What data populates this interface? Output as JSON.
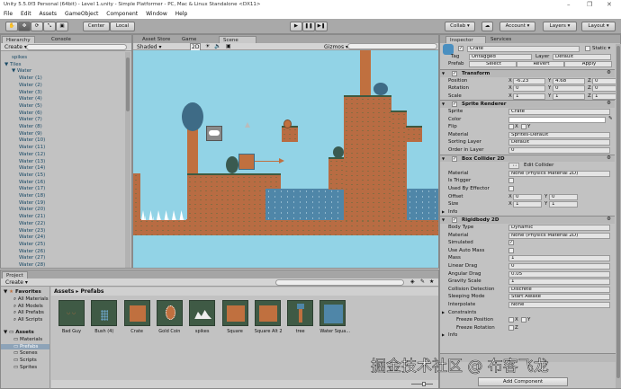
{
  "window": {
    "title": "Unity 5.5.0f3 Personal (64bit) - Level 1.unity - Simple Platformer - PC, Mac & Linux Standalone <DX11>",
    "minimize": "–",
    "maximize": "❐",
    "close": "✕"
  },
  "menu": [
    "File",
    "Edit",
    "Assets",
    "GameObject",
    "Component",
    "Window",
    "Help"
  ],
  "toolbar": {
    "center": "Center",
    "local": "Local",
    "collab": "Collab ▾",
    "account": "Account ▾",
    "layers": "Layers ▾",
    "layout": "Layout ▾",
    "play": "▶",
    "pause": "❚❚",
    "step": "▶❚"
  },
  "hierarchy": {
    "tab": "Hierarchy",
    "console_tab": "Console",
    "create": "Create ▾",
    "items": [
      {
        "label": "spikes",
        "indent": 1
      },
      {
        "label": "▼ Tiles",
        "indent": 0
      },
      {
        "label": "▼ Water",
        "indent": 1
      },
      {
        "label": "Water (1)",
        "indent": 2
      },
      {
        "label": "Water (2)",
        "indent": 2
      },
      {
        "label": "Water (3)",
        "indent": 2
      },
      {
        "label": "Water (4)",
        "indent": 2
      },
      {
        "label": "Water (5)",
        "indent": 2
      },
      {
        "label": "Water (6)",
        "indent": 2
      },
      {
        "label": "Water (7)",
        "indent": 2
      },
      {
        "label": "Water (8)",
        "indent": 2
      },
      {
        "label": "Water (9)",
        "indent": 2
      },
      {
        "label": "Water (10)",
        "indent": 2
      },
      {
        "label": "Water (11)",
        "indent": 2
      },
      {
        "label": "Water (12)",
        "indent": 2
      },
      {
        "label": "Water (13)",
        "indent": 2
      },
      {
        "label": "Water (14)",
        "indent": 2
      },
      {
        "label": "Water (15)",
        "indent": 2
      },
      {
        "label": "Water (16)",
        "indent": 2
      },
      {
        "label": "Water (17)",
        "indent": 2
      },
      {
        "label": "Water (18)",
        "indent": 2
      },
      {
        "label": "Water (19)",
        "indent": 2
      },
      {
        "label": "Water (20)",
        "indent": 2
      },
      {
        "label": "Water (21)",
        "indent": 2
      },
      {
        "label": "Water (22)",
        "indent": 2
      },
      {
        "label": "Water (23)",
        "indent": 2
      },
      {
        "label": "Water (24)",
        "indent": 2
      },
      {
        "label": "Water (25)",
        "indent": 2
      },
      {
        "label": "Water (26)",
        "indent": 2
      },
      {
        "label": "Water (27)",
        "indent": 2
      },
      {
        "label": "Water (28)",
        "indent": 2
      }
    ]
  },
  "scene": {
    "tabs": [
      "Asset Store",
      "Game",
      "Scene"
    ],
    "shading": "Shaded ▾",
    "mode2d": "2D",
    "gizmos": "Gizmos ▾"
  },
  "inspector": {
    "tab": "Inspector",
    "services_tab": "Services",
    "name": "Crate",
    "static": "Static ▾",
    "tag_label": "Tag",
    "tag": "Untagged",
    "layer_label": "Layer",
    "layer": "Default",
    "prefab_label": "Prefab",
    "select": "Select",
    "revert": "Revert",
    "apply": "Apply",
    "rows": [
      {
        "type": "hdr",
        "label": "Transform"
      },
      {
        "type": "xyz",
        "label": "Position",
        "v": [
          "-6.23",
          "4.68",
          "0"
        ]
      },
      {
        "type": "xyz",
        "label": "Rotation",
        "v": [
          "0",
          "0",
          "0"
        ]
      },
      {
        "type": "xyz",
        "label": "Scale",
        "v": [
          "1",
          "1",
          "1"
        ]
      },
      {
        "type": "hdr",
        "label": "Sprite Renderer"
      },
      {
        "type": "field",
        "label": "Sprite",
        "value": "Crate"
      },
      {
        "type": "color",
        "label": "Color"
      },
      {
        "type": "checks",
        "label": "Flip",
        "checks": [
          "X",
          "Y"
        ]
      },
      {
        "type": "field",
        "label": "Material",
        "value": "Sprites-Default"
      },
      {
        "type": "field",
        "label": "Sorting Layer",
        "value": "Default"
      },
      {
        "type": "field",
        "label": "Order in Layer",
        "value": "0"
      },
      {
        "type": "hdr",
        "label": "Box Collider 2D"
      },
      {
        "type": "button",
        "label": "",
        "value": "Edit Collider"
      },
      {
        "type": "field",
        "label": "Material",
        "value": "None (Physics Material 2D)"
      },
      {
        "type": "checks",
        "label": "Is Trigger",
        "checks": [
          ""
        ]
      },
      {
        "type": "checks",
        "label": "Used By Effector",
        "checks": [
          ""
        ]
      },
      {
        "type": "xy",
        "label": "Offset",
        "v": [
          "0",
          "0"
        ]
      },
      {
        "type": "xy",
        "label": "Size",
        "v": [
          "1",
          "1"
        ]
      },
      {
        "type": "fold",
        "label": "Info"
      },
      {
        "type": "hdr",
        "label": "Rigidbody 2D"
      },
      {
        "type": "field",
        "label": "Body Type",
        "value": "Dynamic"
      },
      {
        "type": "field",
        "label": "Material",
        "value": "None (Physics Material 2D)"
      },
      {
        "type": "checks",
        "label": "Simulated",
        "checks": [
          "✓"
        ]
      },
      {
        "type": "checks",
        "label": "Use Auto Mass",
        "checks": [
          ""
        ]
      },
      {
        "type": "field",
        "label": "Mass",
        "value": "1"
      },
      {
        "type": "field",
        "label": "Linear Drag",
        "value": "0"
      },
      {
        "type": "field",
        "label": "Angular Drag",
        "value": "0.05"
      },
      {
        "type": "field",
        "label": "Gravity Scale",
        "value": "1"
      },
      {
        "type": "field",
        "label": "Collision Detection",
        "value": "Discrete"
      },
      {
        "type": "field",
        "label": "Sleeping Mode",
        "value": "Start Awake"
      },
      {
        "type": "field",
        "label": "Interpolate",
        "value": "None"
      },
      {
        "type": "fold",
        "label": "Constraints"
      },
      {
        "type": "checks",
        "label": "Freeze Position",
        "checks": [
          "X",
          "Y"
        ],
        "indent": true
      },
      {
        "type": "checks",
        "label": "Freeze Rotation",
        "checks": [
          "Z"
        ],
        "indent": true
      },
      {
        "type": "fold",
        "label": "Info"
      }
    ],
    "add_component": "Add Component"
  },
  "project": {
    "tab": "Project",
    "create": "Create ▾",
    "breadcrumb": [
      "Assets",
      "Prefabs"
    ],
    "favorites": {
      "label": "Favorites",
      "items": [
        "All Materials",
        "All Models",
        "All Prefabs",
        "All Scripts"
      ]
    },
    "assets": {
      "label": "Assets",
      "items": [
        "Materials",
        "Prefabs",
        "Scenes",
        "Scripts",
        "Sprites"
      ],
      "selected": "Prefabs"
    },
    "prefabs": [
      "Bad Guy",
      "Bush (4)",
      "Crate",
      "Gold Coin",
      "spikes",
      "Square",
      "Square Alt 2",
      "tree",
      "Water Squa..."
    ]
  },
  "watermark": "掘金技术社区 @ 布客飞龙"
}
